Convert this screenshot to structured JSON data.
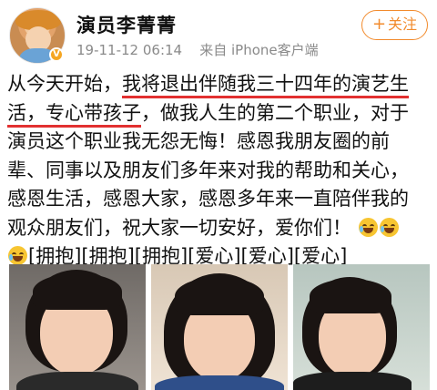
{
  "post": {
    "username": "演员李菁菁",
    "timestamp": "19-11-12 06:14",
    "source_prefix": "来自",
    "source": "iPhone客户端",
    "follow_label": "关注",
    "lines": [
      {
        "plain": "从今天开始，",
        "underlined": "我将退出伴随我三十四年的演艺生",
        "rest": ""
      },
      {
        "plain": "",
        "underlined": "活，专心带孩子",
        "rest": "，做我人生的第二个职业，对于"
      },
      {
        "plain": "演员这个职业我无怨无悔！感恩我朋友圈的前",
        "underlined": "",
        "rest": ""
      },
      {
        "plain": "辈、同事以及朋友们多年来对我的帮助和关心，",
        "underlined": "",
        "rest": ""
      },
      {
        "plain": "感恩生活，感恩大家，感恩多年来一直陪伴我的",
        "underlined": "",
        "rest": ""
      },
      {
        "plain": "观众朋友们，祝大家一切安好，爱你们！",
        "underlined": "",
        "rest": ""
      },
      {
        "plain": "[拥抱][拥抱][拥抱][爱心][爱心][爱心]",
        "underlined": "",
        "rest": ""
      }
    ],
    "emoji_icon": "laugh-cry-icon",
    "accent_color": "#f28b2d",
    "underline_color": "#e23030"
  }
}
